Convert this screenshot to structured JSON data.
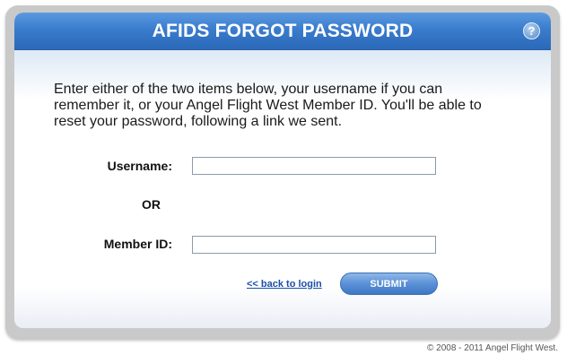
{
  "header": {
    "title": "AFIDS FORGOT PASSWORD",
    "help_icon_glyph": "?"
  },
  "intro_text": "Enter either of the two items below, your username if you can remember it, or your Angel Flight West Member ID. You'll be able to reset your password, following a link we sent.",
  "form": {
    "username_label": "Username:",
    "username_value": "",
    "or_text": "OR",
    "member_id_label": "Member ID:",
    "member_id_value": ""
  },
  "actions": {
    "back_link": "<< back to login",
    "submit_label": "SUBMIT"
  },
  "footer": {
    "copyright": "© 2008 - 2011 Angel Flight West."
  },
  "colors": {
    "header_blue": "#3a7ccd",
    "button_blue": "#5a90d6",
    "link_blue": "#1a4fa6",
    "frame_gray": "#c9c9c9"
  },
  "icons": [
    "help-icon"
  ]
}
